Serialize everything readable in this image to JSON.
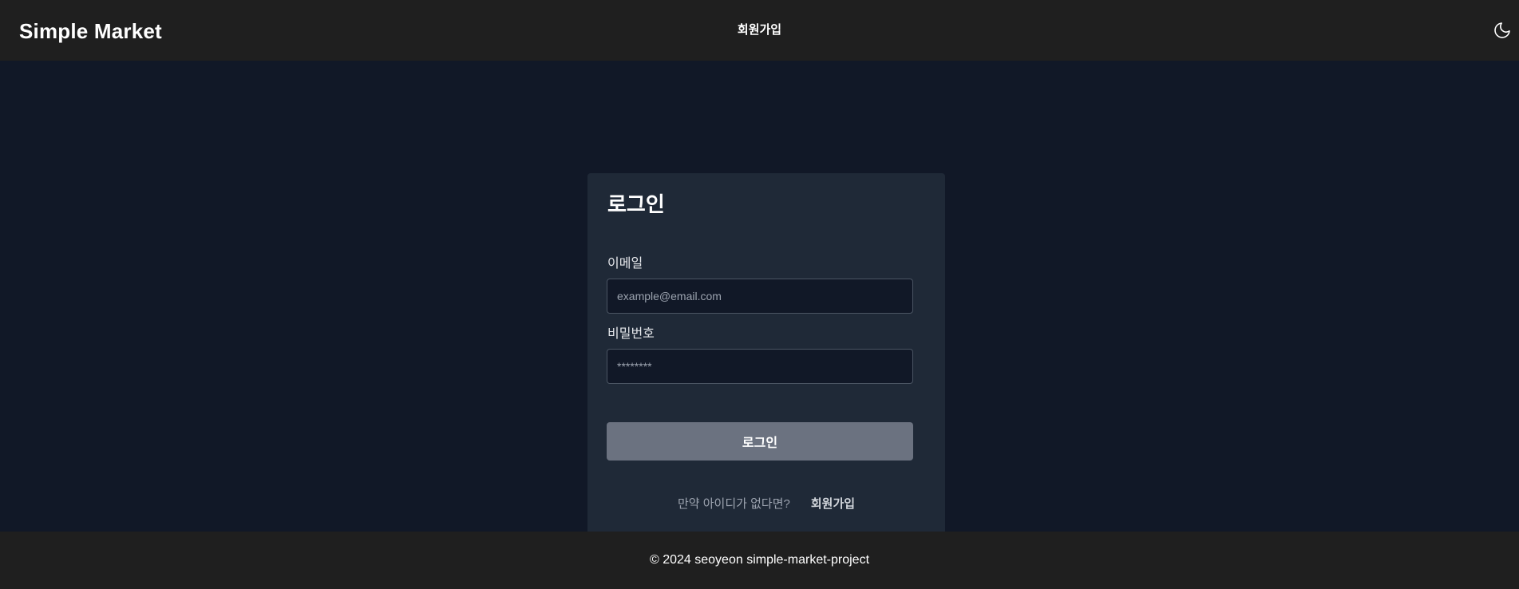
{
  "header": {
    "brand": "Simple Market",
    "nav_signup": "회원가입",
    "theme_toggle_icon": "moon-icon"
  },
  "login": {
    "title": "로그인",
    "email_label": "이메일",
    "email_placeholder": "example@email.com",
    "email_value": "",
    "password_label": "비밀번호",
    "password_placeholder": "********",
    "password_value": "",
    "submit_label": "로그인",
    "signup_prompt": "만약 아이디가 없다면?",
    "signup_link": "회원가입"
  },
  "footer": {
    "copyright": "© 2024 seoyeon simple-market-project"
  },
  "colors": {
    "header_bg": "#1f1f1f",
    "page_bg": "#111827",
    "card_bg": "#1f2937",
    "input_bg": "#111827",
    "button_bg": "#6b7280"
  }
}
